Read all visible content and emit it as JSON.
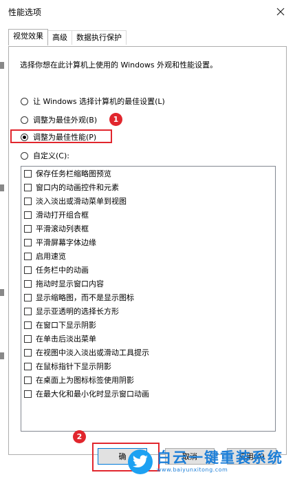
{
  "window": {
    "title": "性能选项"
  },
  "tabs": [
    {
      "label": "视觉效果",
      "active": true
    },
    {
      "label": "高级",
      "active": false
    },
    {
      "label": "数据执行保护",
      "active": false
    }
  ],
  "description": "选择你想在此计算机上使用的 Windows 外观和性能设置。",
  "radios": [
    {
      "label": "让 Windows 选择计算机的最佳设置(L)",
      "checked": false
    },
    {
      "label": "调整为最佳外观(B)",
      "checked": false
    },
    {
      "label": "调整为最佳性能(P)",
      "checked": true
    },
    {
      "label": "自定义(C):",
      "checked": false
    }
  ],
  "effects": [
    "保存任务栏缩略图预览",
    "窗口内的动画控件和元素",
    "淡入淡出或滑动菜单到视图",
    "滑动打开组合框",
    "平滑滚动列表框",
    "平滑屏幕字体边缘",
    "启用速览",
    "任务栏中的动画",
    "拖动时显示窗口内容",
    "显示缩略图，而不是显示图标",
    "显示亚透明的选择长方形",
    "在窗口下显示阴影",
    "在单击后淡出菜单",
    "在视图中淡入淡出或滑动工具提示",
    "在鼠标指针下显示阴影",
    "在桌面上为图标标签使用阴影",
    "在最大化和最小化时显示窗口动画"
  ],
  "buttons": {
    "ok": "确",
    "cancel": "取消",
    "apply": "应用(A)"
  },
  "annotations": {
    "badge1": "1",
    "badge2": "2"
  },
  "watermark": {
    "main": "白云一键重装系统",
    "sub": "www.baiyunxitong.com"
  },
  "colors": {
    "highlight": "#e1262d",
    "accent": "#0078d7",
    "watermark": "#1d7fd8"
  }
}
